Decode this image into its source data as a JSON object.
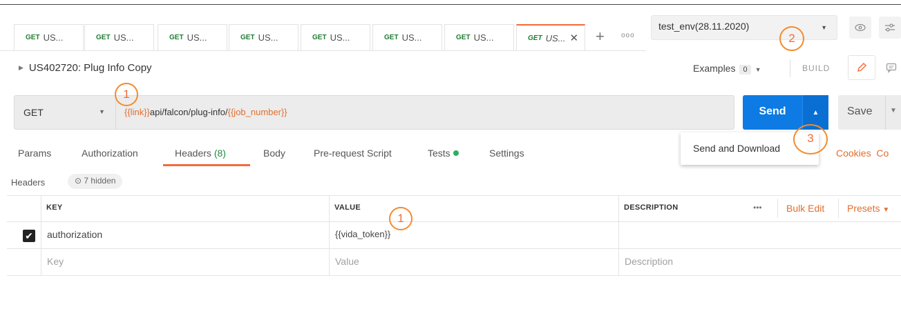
{
  "tabs": [
    {
      "method": "GET",
      "title": "US..."
    },
    {
      "method": "GET",
      "title": "US..."
    },
    {
      "method": "GET",
      "title": "US..."
    },
    {
      "method": "GET",
      "title": "US..."
    },
    {
      "method": "GET",
      "title": "US..."
    },
    {
      "method": "GET",
      "title": "US..."
    },
    {
      "method": "GET",
      "title": "US..."
    },
    {
      "method": "GET",
      "title": "US...",
      "close": "✕"
    }
  ],
  "tab_actions": {
    "add": "+",
    "more": "ooo"
  },
  "environment": {
    "selected": "test_env(28.11.2020)"
  },
  "request": {
    "title": "US402720: Plug Info Copy",
    "method": "GET",
    "url_parts": [
      "{{link}}",
      "api/falcon/plug-info/",
      "{{job_number}}"
    ]
  },
  "examples": {
    "label": "Examples",
    "count": "0"
  },
  "build_label": "BUILD",
  "send": {
    "label": "Send",
    "menu_item": "Send and Download"
  },
  "save": {
    "label": "Save"
  },
  "subtabs": [
    "Params",
    "Authorization",
    "Headers",
    "(8)",
    "Body",
    "Pre-request Script",
    "Tests",
    "Settings"
  ],
  "links": {
    "cookies": "Cookies",
    "code": "Co"
  },
  "headers_section": {
    "label": "Headers",
    "hidden": "7 hidden"
  },
  "table": {
    "columns": [
      "KEY",
      "VALUE",
      "DESCRIPTION"
    ],
    "more": "•••",
    "bulk_edit": "Bulk Edit",
    "presets": "Presets",
    "rows": [
      {
        "key": "authorization",
        "value": "{{vida_token}}",
        "description": ""
      }
    ],
    "placeholders": {
      "key": "Key",
      "value": "Value",
      "description": "Description"
    }
  },
  "callouts": [
    "1",
    "1",
    "2",
    "3"
  ],
  "colors": {
    "accent": "#f26b3a",
    "send": "#0d7be3",
    "variable": "#e36d2d",
    "get": "#1e7d32"
  }
}
